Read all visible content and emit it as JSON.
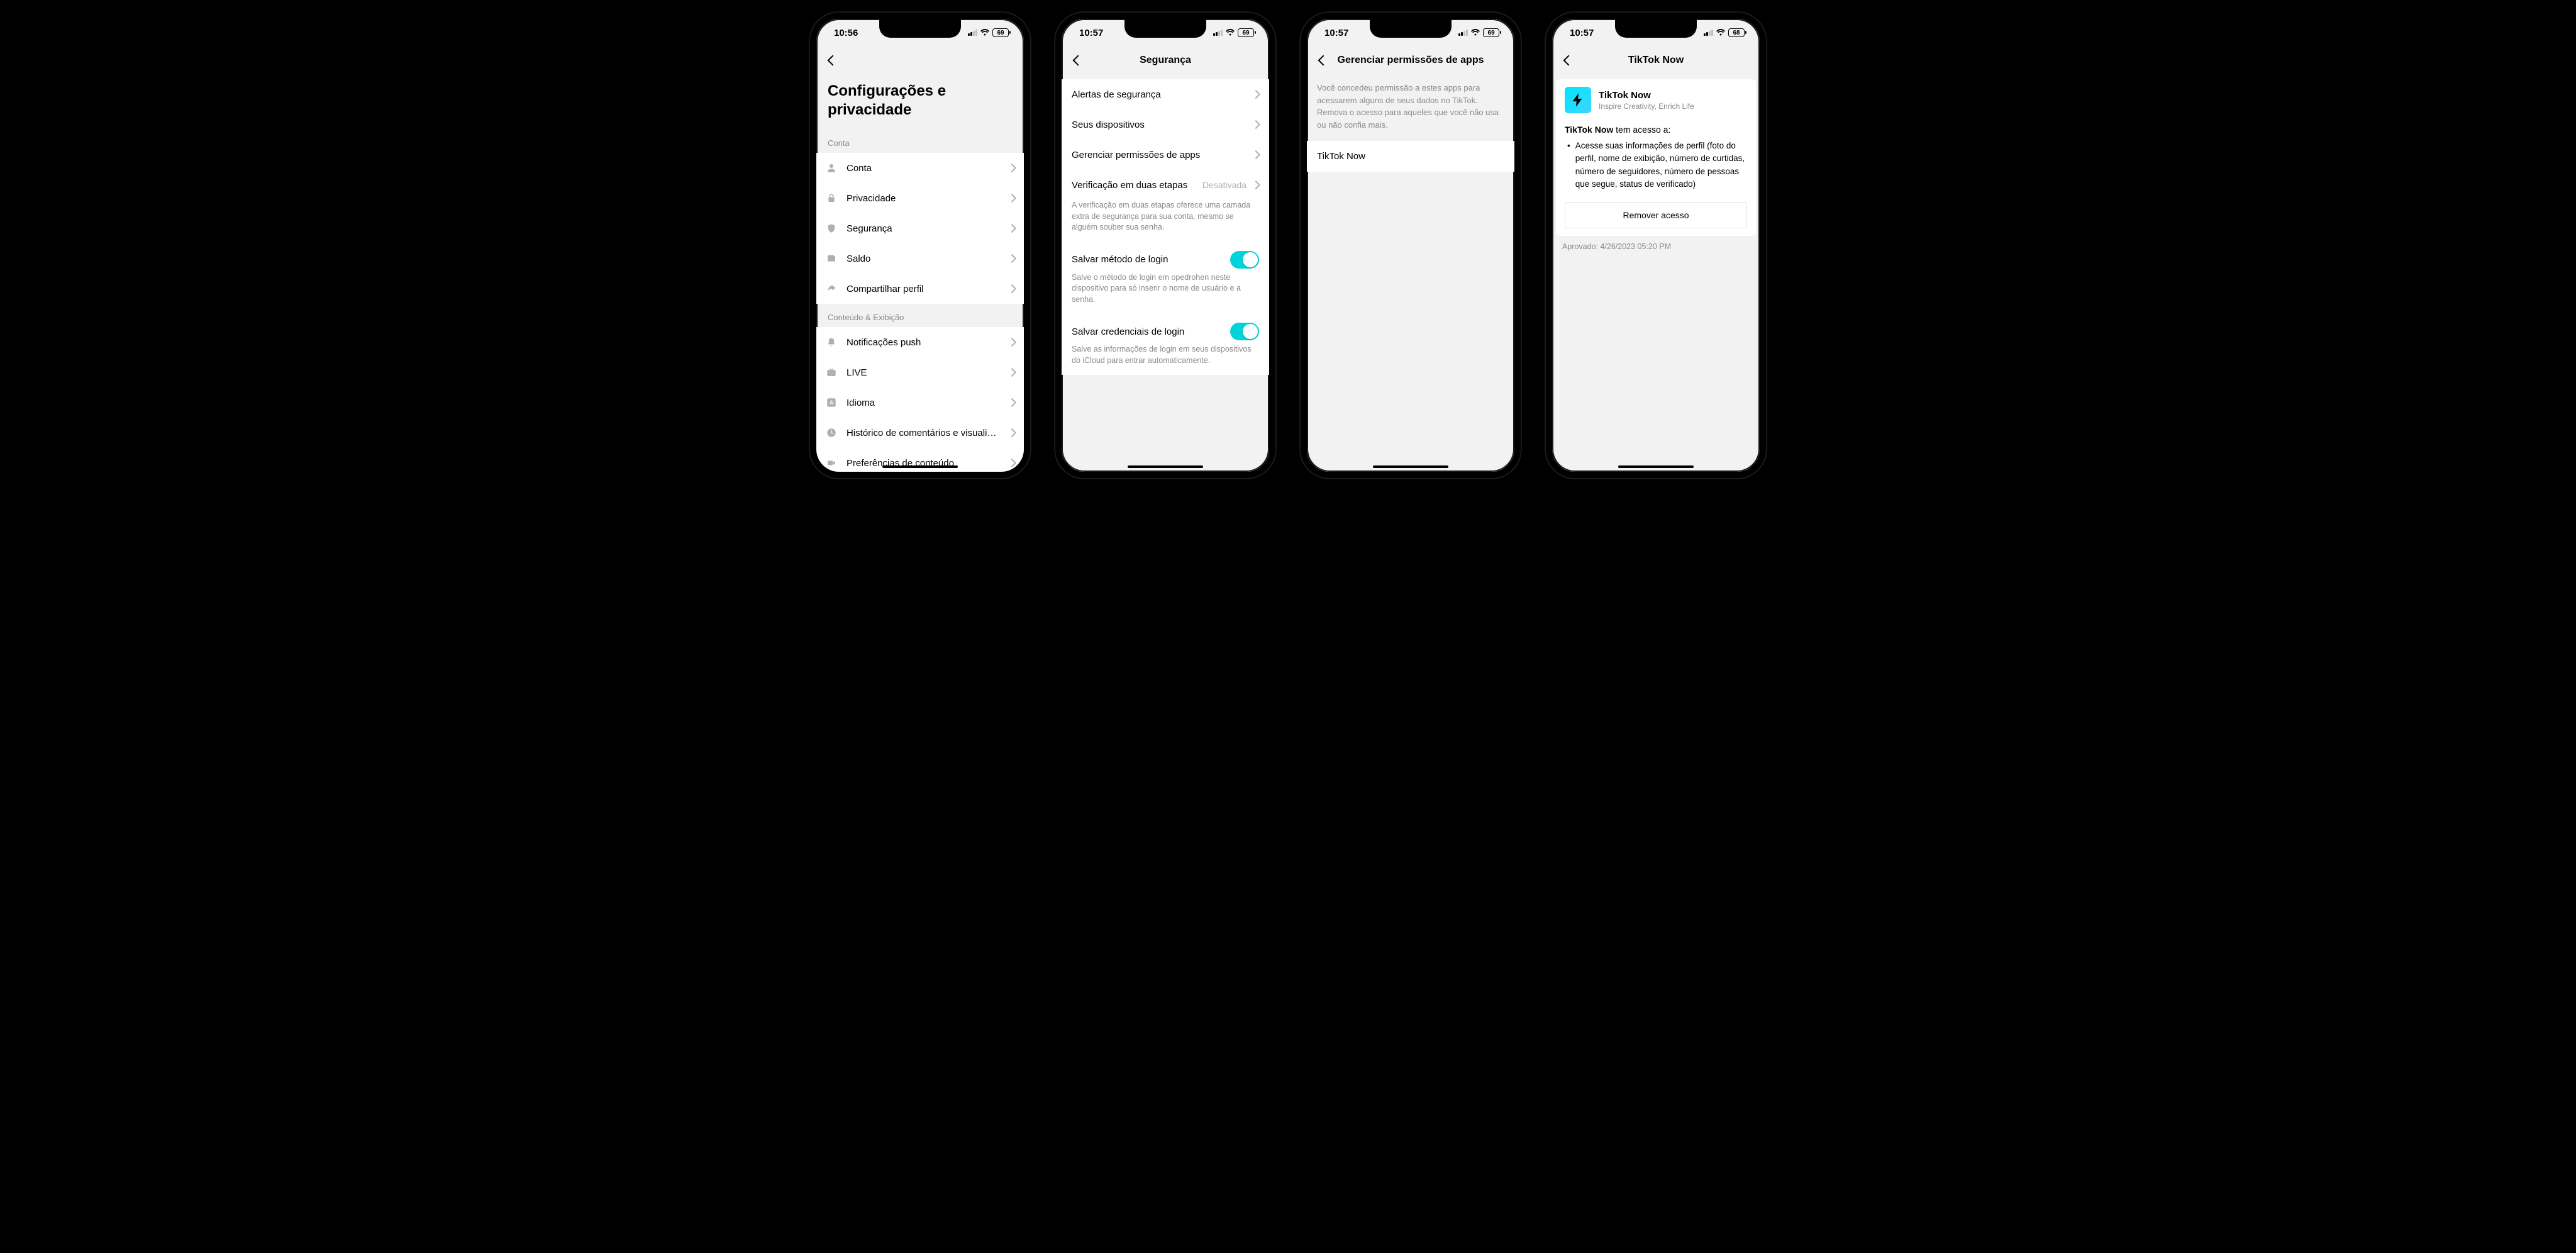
{
  "status": {
    "time1": "10:56",
    "time2": "10:57",
    "time3": "10:57",
    "time4": "10:57",
    "battery1": "69",
    "battery4": "68"
  },
  "s1": {
    "title": "Configurações e privacidade",
    "sec1": "Conta",
    "rows1": [
      "Conta",
      "Privacidade",
      "Segurança",
      "Saldo",
      "Compartilhar perfil"
    ],
    "sec2": "Conteúdo & Exibição",
    "rows2": [
      "Notificações push",
      "LIVE",
      "Idioma",
      "Histórico de comentários e visualiza...",
      "Preferências de conteúdo"
    ]
  },
  "s2": {
    "title": "Segurança",
    "rows": [
      "Alertas de segurança",
      "Seus dispositivos",
      "Gerenciar permissões de apps"
    ],
    "twostep": {
      "label": "Verificação em duas etapas",
      "value": "Desativada",
      "desc": "A verificação em duas etapas oferece uma camada extra de segurança para sua conta, mesmo se alguém souber sua senha."
    },
    "t1": {
      "label": "Salvar método de login",
      "desc": "Salve o método de login em opedrohen neste dispositivo para só inserir o nome de usuário e a senha."
    },
    "t2": {
      "label": "Salvar credenciais de login",
      "desc": "Salve as informações de login em seus dispositivos do iCloud para entrar automaticamente."
    }
  },
  "s3": {
    "title": "Gerenciar permissões de apps",
    "info": "Você concedeu permissão a estes apps para acessarem alguns de seus dados no TikTok. Remova o acesso para aqueles que você não usa ou não confia mais.",
    "item": "TikTok Now"
  },
  "s4": {
    "title": "TikTok Now",
    "app": {
      "name": "TikTok Now",
      "tagline": "Inspire Creativity, Enrich Life"
    },
    "access_name": "TikTok Now",
    "access_suffix": " tem acesso a:",
    "bullet": "Acesse suas informações de perfil (foto do perfil, nome de exibição, número de curtidas, número de seguidores, número de pessoas que segue, status de verificado)",
    "remove": "Remover acesso",
    "approved": "Aprovado: 4/26/2023 05:20 PM"
  }
}
